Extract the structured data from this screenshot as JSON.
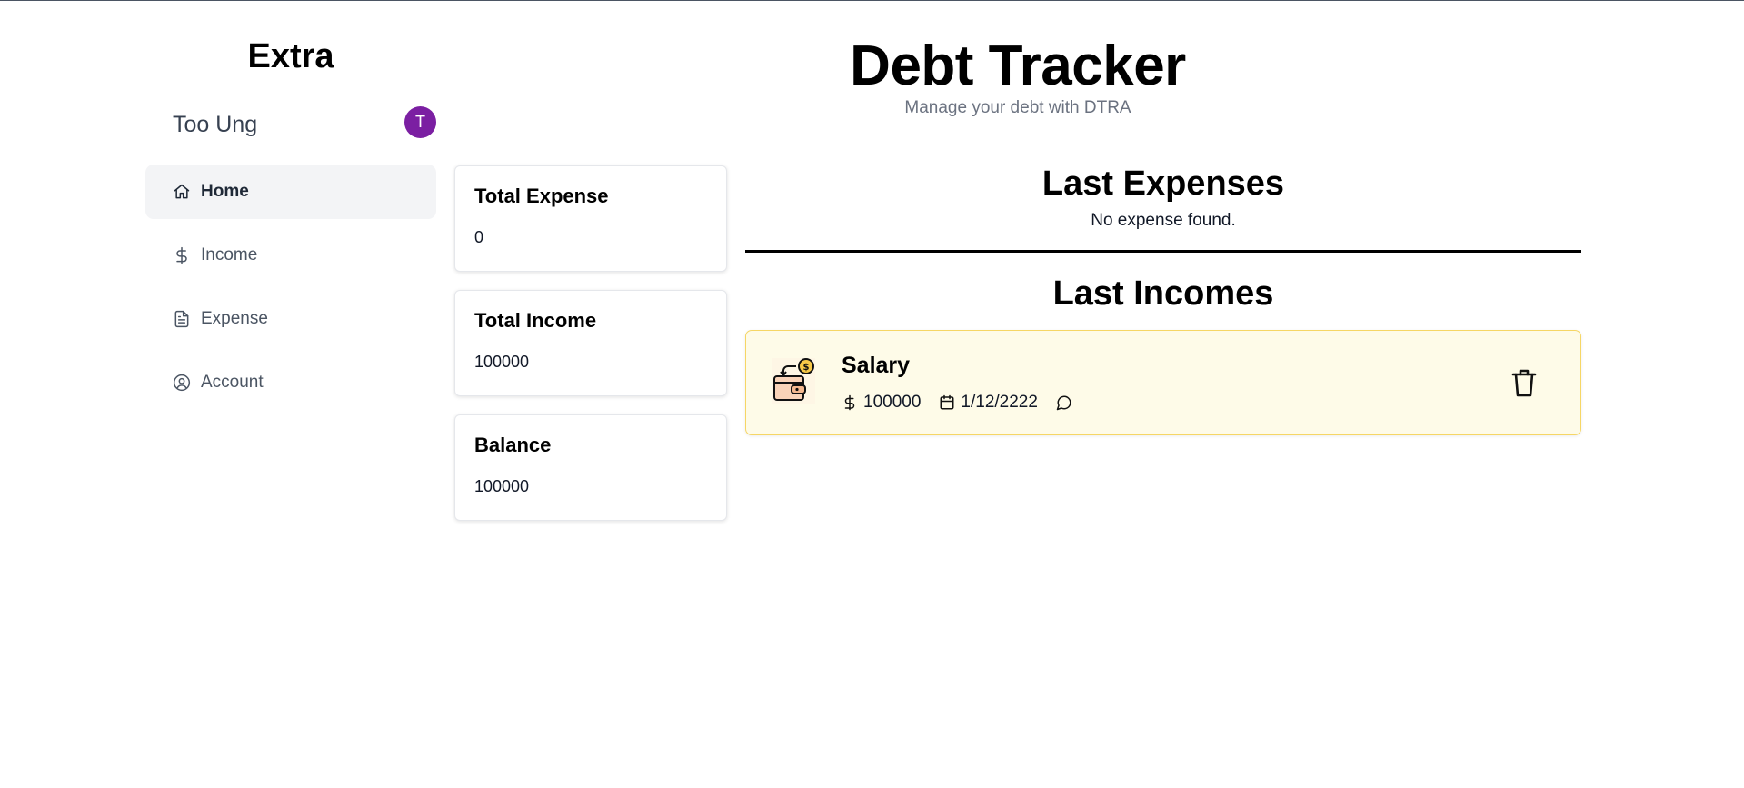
{
  "sidebar": {
    "brand": "Extra",
    "user": {
      "name": "Too Ung",
      "avatar_initial": "T",
      "avatar_color": "#7b1fa2"
    },
    "items": [
      {
        "label": "Home",
        "icon": "home-icon",
        "active": true
      },
      {
        "label": "Income",
        "icon": "dollar-icon",
        "active": false
      },
      {
        "label": "Expense",
        "icon": "document-icon",
        "active": false
      },
      {
        "label": "Account",
        "icon": "user-circle-icon",
        "active": false
      }
    ]
  },
  "header": {
    "title": "Debt Tracker",
    "subtitle": "Manage your debt with DTRA"
  },
  "stats": [
    {
      "title": "Total Expense",
      "value": "0"
    },
    {
      "title": "Total Income",
      "value": "100000"
    },
    {
      "title": "Balance",
      "value": "100000"
    }
  ],
  "expenses": {
    "title": "Last Expenses",
    "empty_text": "No expense found."
  },
  "incomes": {
    "title": "Last Incomes",
    "items": [
      {
        "name": "Salary",
        "amount": "100000",
        "date": "1/12/2222",
        "icon": "wallet-income-icon"
      }
    ]
  },
  "colors": {
    "accent_purple": "#7b1fa2",
    "income_bg": "#fefbe8",
    "income_border": "#f6d665",
    "active_nav_bg": "#f3f4f6"
  }
}
